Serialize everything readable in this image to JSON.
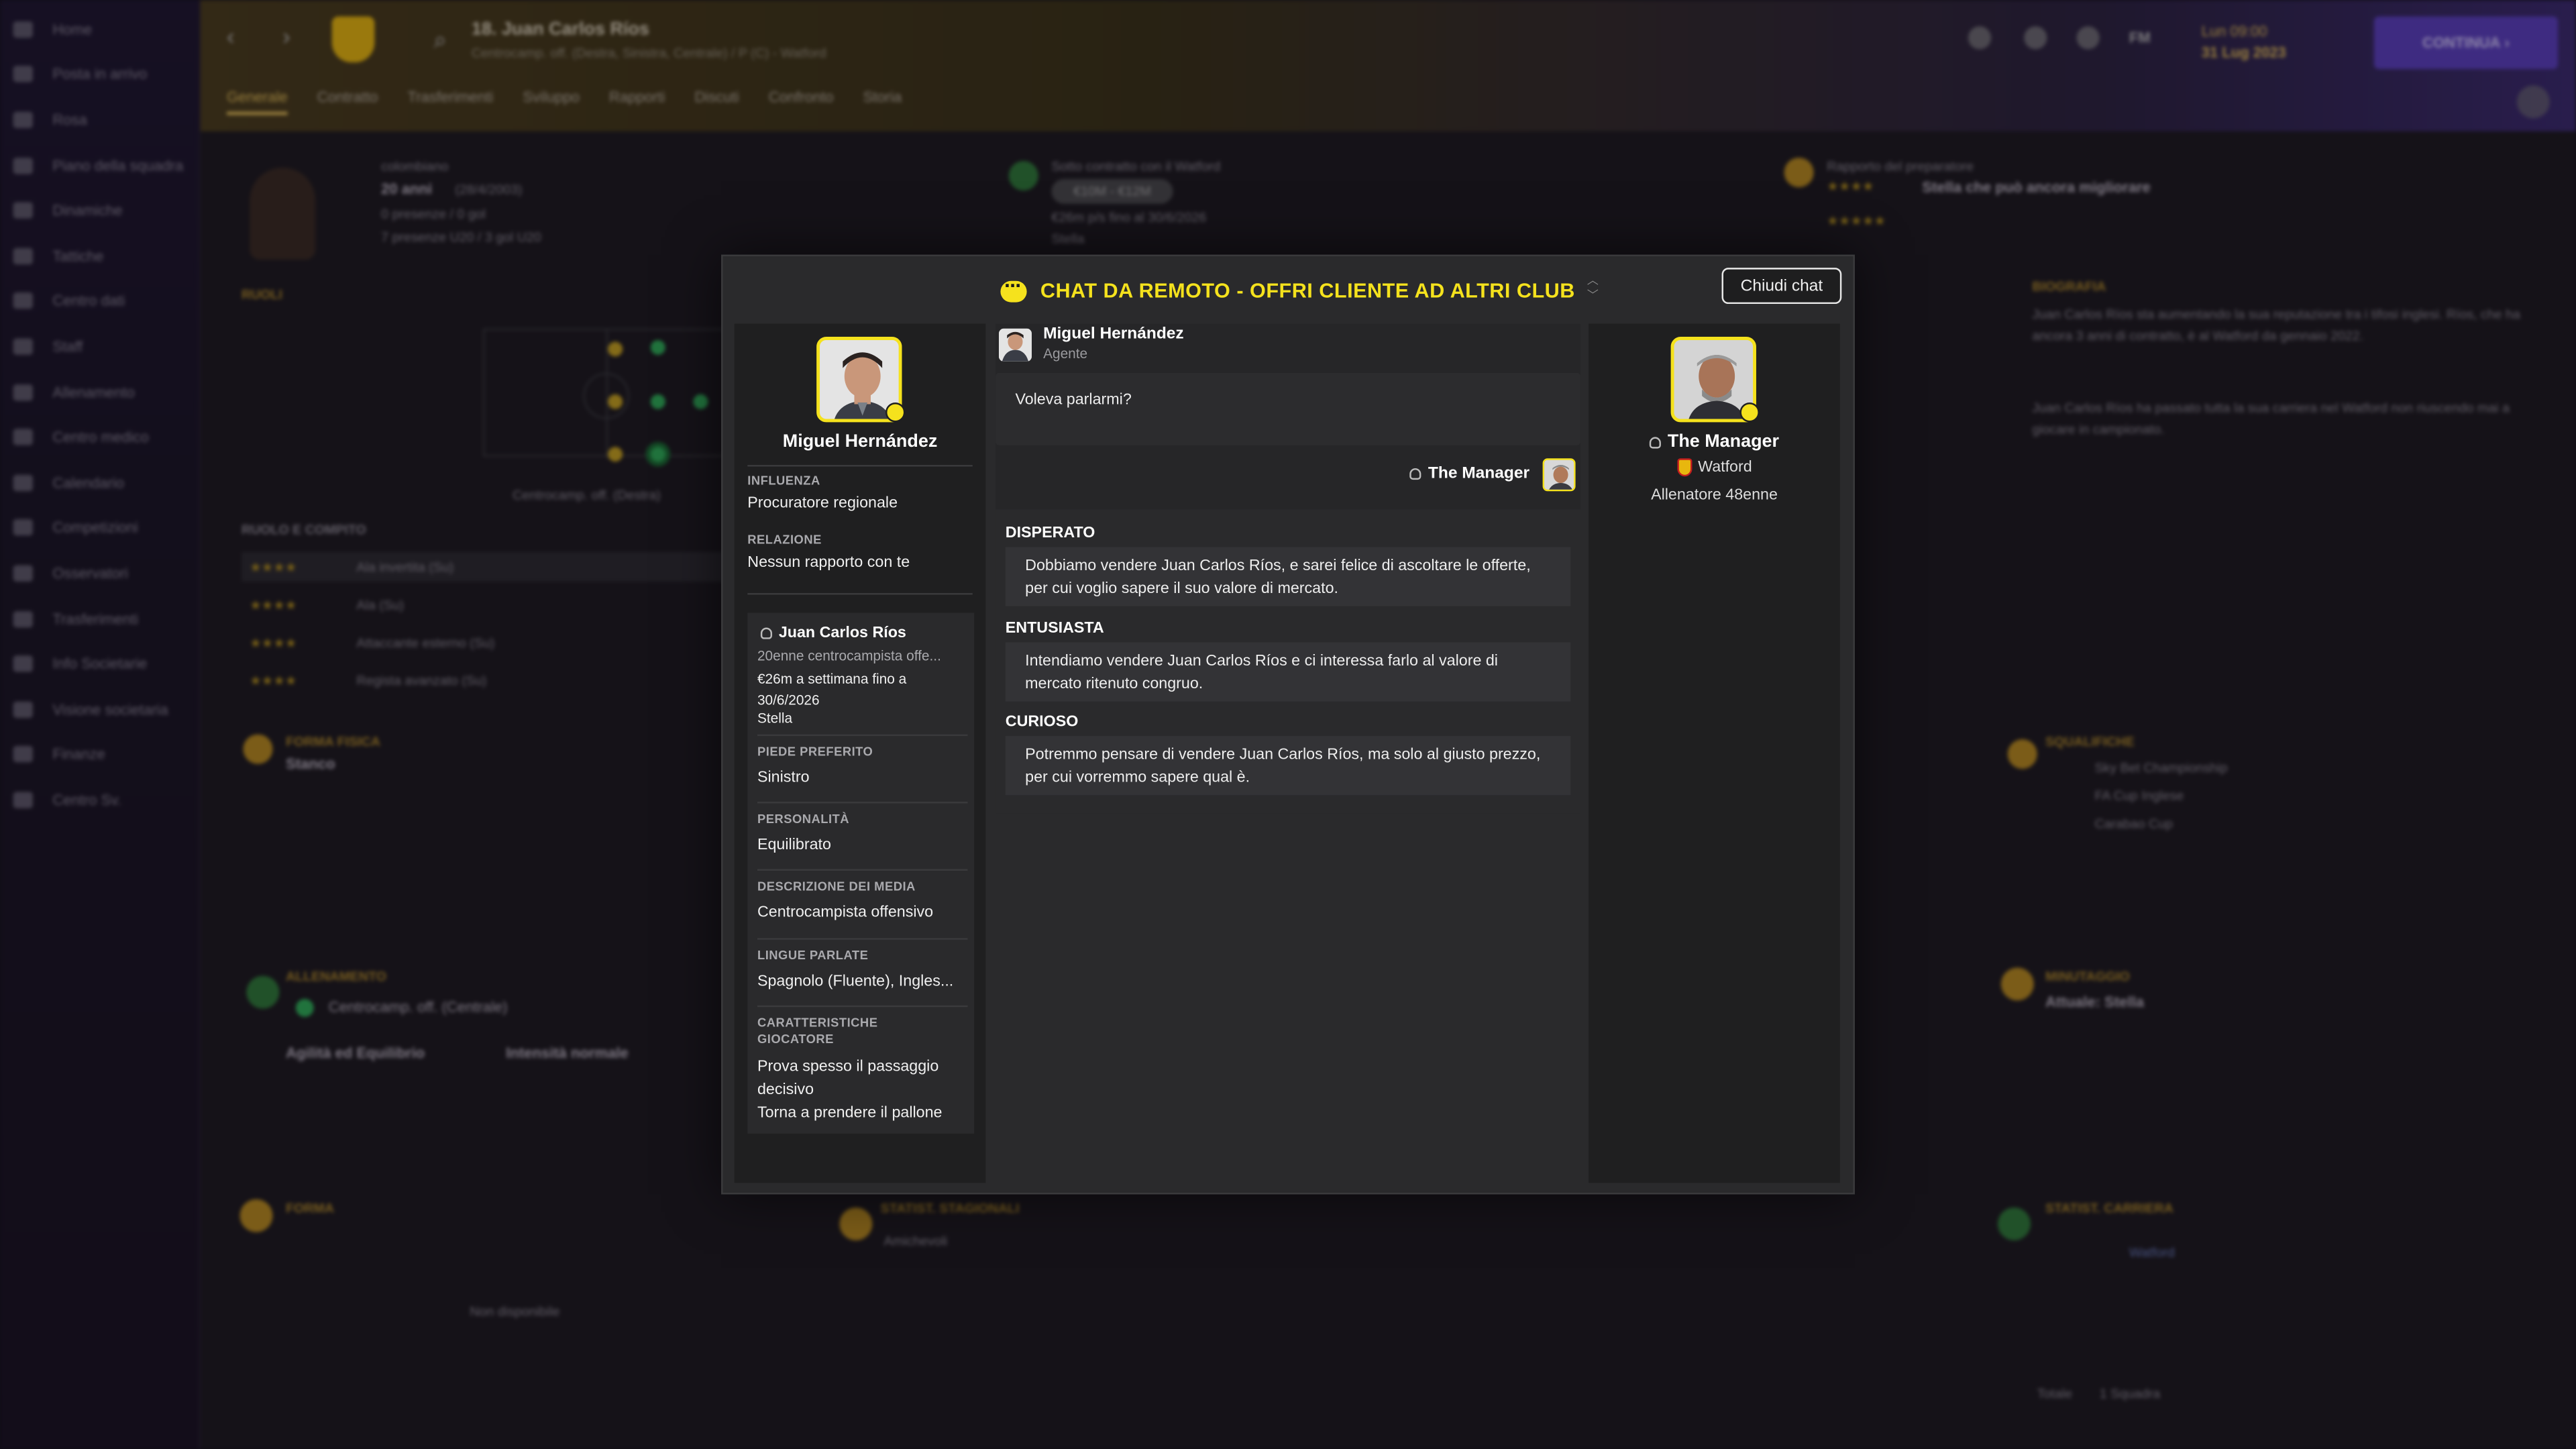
{
  "background": {
    "sidebar": [
      "Home",
      "Posta in arrivo",
      "Rosa",
      "Piano della squadra",
      "Dinamiche",
      "Tattiche",
      "Centro dati",
      "Staff",
      "Allenamento",
      "Centro medico",
      "Calendario",
      "Competizioni",
      "Osservatori",
      "Trasferimenti",
      "Info Societarie",
      "Visione societaria",
      "Finanze",
      "Centro Sv."
    ],
    "header": {
      "player_title": "18. Juan Carlos Ríos",
      "player_sub": "Centrocamp. off. (Destra, Sinistra, Centrale) / P (C) - Watford",
      "tabs": [
        "Generale",
        "Contratto",
        "Trasferimenti",
        "Sviluppo",
        "Rapporti",
        "Discuti",
        "Confronto",
        "Storia"
      ],
      "date_line1": "Lun 09:00",
      "date_line2": "31 Lug 2023",
      "continue_label": "CONTINUA",
      "fm_label": "FM"
    },
    "blocks": {
      "nationality": "colombiano",
      "age": "20 anni",
      "dob": "(28/4/2003)",
      "apps": "0 presenze / 0 gol",
      "apps_u20": "7 presenze U20 / 3 gol U20",
      "contract_title": "Sotto contratto con il Watford",
      "value_range": "€10M - €12M",
      "wage": "€26m p/s fino al 30/6/2026",
      "status": "Stella",
      "scout_title": "Rapporto del preparatore",
      "scout_text": "Stella che può ancora migliorare",
      "roles": "RUOLI",
      "position_caption": "Centrocamp. off. (Destra)",
      "role_duty": "RUOLO E COMPITO",
      "role_rows": [
        "Ala invertita (Su)",
        "Ala (Su)",
        "Attaccante esterno (Su)",
        "Regista avanzato (Su)"
      ],
      "bio_title": "BIOGRAFIA",
      "bio_p1": "Juan Carlos Ríos sta aumentando la sua reputazione tra i tifosi inglesi. Ríos, che ha ancora 3 anni di contratto, è al Watford da gennaio 2022.",
      "bio_p2": "Juan Carlos Ríos ha passato tutta la sua carriera nel Watford non riuscendo mai a giocare in campionato.",
      "fitness_title": "FORMA FISICA",
      "fitness_state": "Stanco",
      "suspensions": "SQUALIFICHE",
      "comps": [
        "Sky Bet Championship",
        "FA Cup Inglese",
        "Carabao Cup"
      ],
      "training_title": "ALLENAMENTO",
      "training_pos": "Centrocamp. off. (Centrale)",
      "training_focus": "Agilità ed Equilibrio",
      "training_int": "Intensità normale",
      "minutes_title": "MINUTAGGIO",
      "minutes_state": "Attuale: Stella",
      "form_title": "FORMA",
      "not_available": "Non disponibile",
      "season_stats": "STATIST. STAGIONALI",
      "friendlies": "Amichevoli",
      "career_stats": "STATIST. CARRIERA",
      "career_team": "Watford",
      "career_total": "Totale",
      "career_total_sq": "1 Squadra"
    }
  },
  "modal": {
    "title": "CHAT DA REMOTO - OFFRI CLIENTE AD ALTRI CLUB",
    "close_label": "Chiudi chat",
    "agent": {
      "name": "Miguel Hernández",
      "influence_label": "INFLUENZA",
      "influence_value": "Procuratore regionale",
      "relation_label": "RELAZIONE",
      "relation_value": "Nessun rapporto con te"
    },
    "player": {
      "name": "Juan Carlos Ríos",
      "desc": "20enne centrocampista offe...",
      "wage": "€26m a settimana fino a 30/6/2026",
      "status": "Stella",
      "foot_label": "PIEDE PREFERITO",
      "foot_value": "Sinistro",
      "personality_label": "PERSONALITÀ",
      "personality_value": "Equilibrato",
      "media_label": "DESCRIZIONE DEI MEDIA",
      "media_value": "Centrocampista offensivo",
      "languages_label": "LINGUE PARLATE",
      "languages_value": "Spagnolo (Fluente), Ingles...",
      "traits_label": "CARATTERISTICHE GIOCATORE",
      "trait_1": "Prova spesso il passaggio decisivo",
      "trait_2": "Torna a prendere il pallone"
    },
    "chat": {
      "sender_name": "Miguel Hernández",
      "sender_role": "Agente",
      "message": "Voleva parlarmi?",
      "reply_name": "The Manager",
      "options": [
        {
          "title": "DISPERATO",
          "text": "Dobbiamo vendere Juan Carlos Ríos, e sarei felice di ascoltare le offerte, per cui voglio sapere il suo valore di mercato."
        },
        {
          "title": "ENTUSIASTA",
          "text": "Intendiamo vendere Juan Carlos Ríos e ci interessa farlo al valore di mercato ritenuto congruo."
        },
        {
          "title": "CURIOSO",
          "text": "Potremmo pensare di vendere Juan Carlos Ríos, ma solo al giusto prezzo, per cui vorremmo sapere qual è."
        }
      ]
    },
    "manager": {
      "name": "The Manager",
      "club": "Watford",
      "role": "Allenatore 48enne"
    }
  },
  "colors": {
    "accent_yellow": "#f5e21d",
    "panel_dark": "#1f1f20",
    "modal_bg": "#2a2a2c",
    "continue_purple": "#5b3fc0"
  }
}
